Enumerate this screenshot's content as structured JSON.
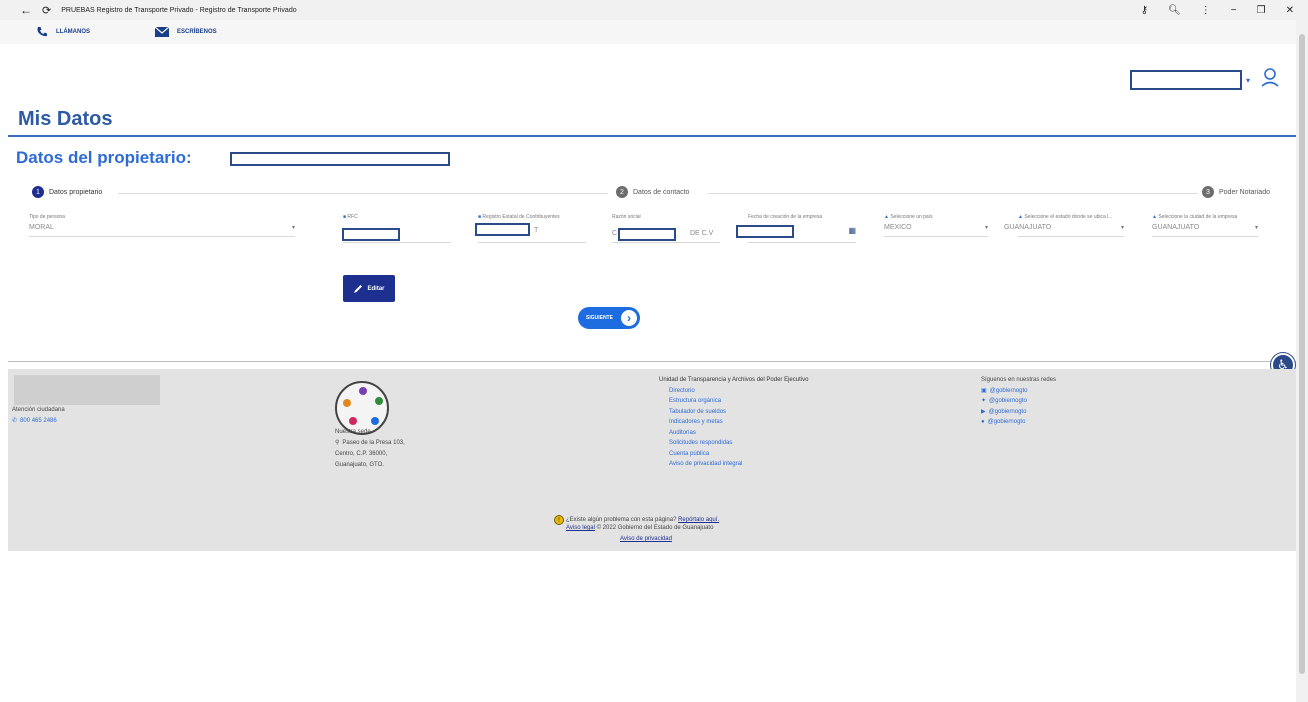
{
  "browser": {
    "title": "PRUEBAS Registro de Transporte Privado - Registro de Transporte Privado",
    "minimize": "−",
    "maximize": "❐",
    "close": "✕",
    "menu": "⋮"
  },
  "topbar": {
    "call_label": "LLÁMANOS",
    "mail_label": "ESCRÍBENOS"
  },
  "page": {
    "title": "Mis Datos",
    "subtitle": "Datos del propietario:"
  },
  "steps": [
    {
      "num": "1",
      "label": "Datos propietario",
      "active": true
    },
    {
      "num": "2",
      "label": "Datos de contacto",
      "active": false
    },
    {
      "num": "3",
      "label": "Poder Notariado",
      "active": false
    }
  ],
  "form": {
    "tipo_persona": {
      "label": "Tipo de persona",
      "value": "MORAL"
    },
    "rfc": {
      "label": "RFC"
    },
    "registro": {
      "label": "Registro Estatal de Contribuyentes",
      "suffix": "T"
    },
    "razon": {
      "label": "Razón social",
      "prefix": "C",
      "suffix": "DE C.V"
    },
    "fecha": {
      "label": "Fecha de creación de la empresa"
    },
    "pais": {
      "label": "Seleccione un país",
      "value": "MEXICO"
    },
    "estado": {
      "label": "Seleccione el estado donde se ubica l...",
      "value": "GUANAJUATO"
    },
    "ciudad": {
      "label": "Seleccione la ciudad de la empresa",
      "value": "GUANAJUATO"
    }
  },
  "buttons": {
    "edit": "Editar",
    "next": "SIGUIENTE"
  },
  "footer": {
    "attention": "Atención ciudadana",
    "phone": "800 465 2486",
    "seat_title": "Nuestra sede",
    "address": [
      "Paseo de la Presa 103,",
      "Centro, C.P. 36000,",
      "Guanajuato, GTO."
    ],
    "transparency_title": "Unidad de Transparencia y Archivos del Poder Ejecutivo",
    "transparency_links": [
      "Directorio",
      "Estructura orgánica",
      "Tabulador de sueldos",
      "Indicadores y metas",
      "Auditorías",
      "Solicitudes respondidas",
      "Cuenta pública",
      "Aviso de privacidad integral"
    ],
    "social_title": "Síguenos en nuestras redes",
    "social": [
      "@gobiernogto",
      "@gobiernogto",
      "@gobiernogto",
      "@gobiernogto"
    ],
    "problem_text": "¿Existe algún problema con esta página?",
    "report_link": "Repórtalo aquí.",
    "legal_link": "Aviso legal",
    "copyright": "© 2022 Gobierno del Estado de Guanajuato",
    "privacy_link": "Aviso de privacidad"
  },
  "colors": {
    "brand_blue": "#2d6bd6",
    "navy": "#1d2f8f"
  }
}
